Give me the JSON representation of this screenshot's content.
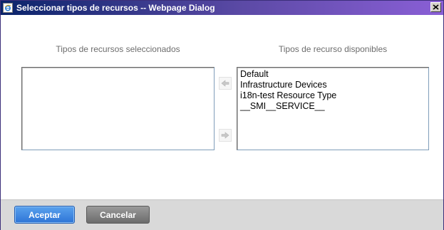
{
  "window": {
    "title": "Seleccionar tipos de recursos -- Webpage Dialog"
  },
  "panels": {
    "selected_label": "Tipos de recursos seleccionados",
    "available_label": "Tipos de recurso disponibles",
    "selected_items": [],
    "available_items": [
      "Default",
      "Infrastructure Devices",
      "i18n-test Resource Type",
      "__SMI__SERVICE__"
    ]
  },
  "buttons": {
    "accept_label": "Aceptar",
    "cancel_label": "Cancelar"
  },
  "icons": {
    "window_icon": "ie-page-icon",
    "close": "close-icon",
    "move_left": "arrow-left-icon",
    "move_right": "arrow-right-icon"
  },
  "colors": {
    "titlebar_start": "#0a246a",
    "titlebar_end": "#8a5fd6",
    "accept_button": "#2d74d6",
    "cancel_button": "#6c6c6c",
    "footer": "#d9d9d9"
  }
}
